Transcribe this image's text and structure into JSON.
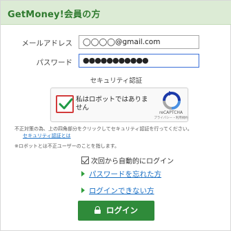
{
  "header": {
    "title": "GetMoney!会員の方"
  },
  "form": {
    "email_label": "メールアドレス",
    "email_value": "◯◯◯◯@gmail.com",
    "password_label": "パスワード",
    "password_value": "●●●●●●●●●●●"
  },
  "security": {
    "title": "セキュリティ認証",
    "captcha": {
      "checked": true,
      "label": "私はロボットではありません",
      "brand": "reCAPTCHA",
      "terms": "プライバシー・利用規約"
    },
    "note1_a": "不正対策の為、上の四角部分をクリックしてセキュリティ認証を行ってください。",
    "note1_link": "セキュリティ認証とは",
    "note2": "※ロボットとは不正ユーザーのことを指します。"
  },
  "auto_login": {
    "label": "次回から自動的にログイン",
    "checked": true
  },
  "links": {
    "forgot_password": "パスワードを忘れた方",
    "cannot_login": "ログインできない方"
  },
  "login_button": {
    "label": "ログイン"
  },
  "colors": {
    "accent": "#2f8b3a",
    "header_bg": "#dcebd5",
    "link": "#1a6fc4",
    "captcha_border": "#d23a3a"
  }
}
